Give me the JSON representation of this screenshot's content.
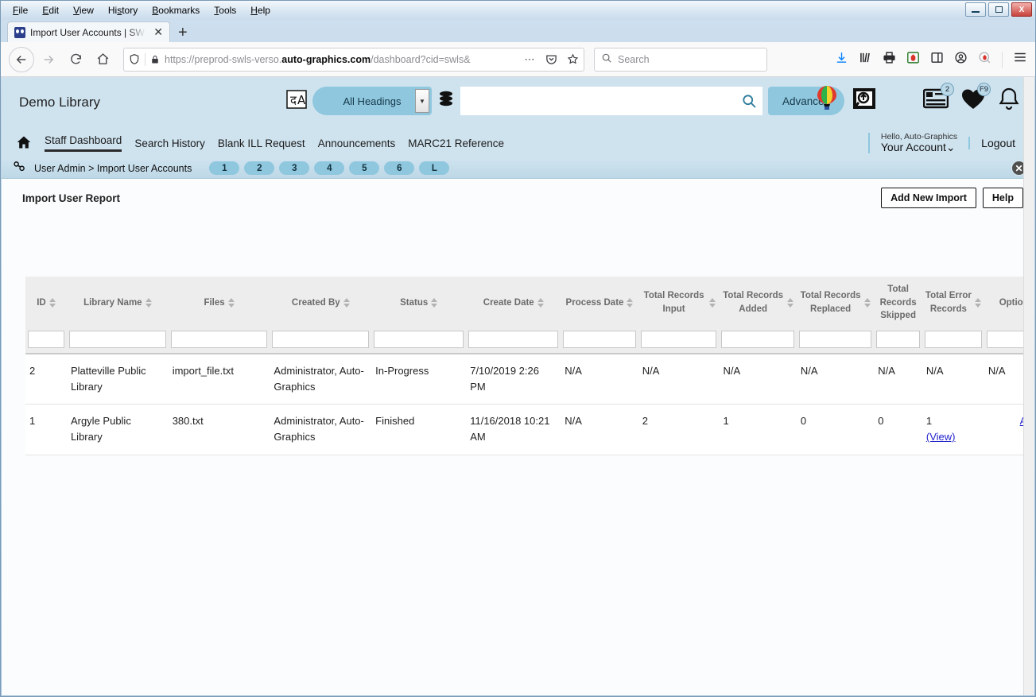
{
  "browser": {
    "menu": [
      "File",
      "Edit",
      "View",
      "History",
      "Bookmarks",
      "Tools",
      "Help"
    ],
    "window_controls": {
      "minimize": "minimize-button",
      "maximize": "maximize-button",
      "close": "X"
    },
    "tab_title": "Import User Accounts | SWLS | ",
    "tab_close": "✕",
    "new_tab": "+",
    "url_prefix": "https://preprod-swls-verso.",
    "url_domain": "auto-graphics.com",
    "url_suffix": "/dashboard?cid=swls&",
    "search_placeholder": "Search",
    "toolbar_icons": [
      "download-icon",
      "library-icon",
      "print-icon",
      "pocket-icon",
      "sidebar-icon",
      "account-icon",
      "container-icon",
      "hamburger-menu-icon"
    ]
  },
  "app": {
    "brand": "Demo Library",
    "search": {
      "scope_label": "All Headings",
      "scope_caret": "▼",
      "input_value": "",
      "advanced_label": "Advanced",
      "database_icon": "database-icon",
      "translate_icon": "translate-icon",
      "magnifier_icon": "search-icon"
    },
    "header_icons": [
      {
        "name": "balloon-icon",
        "badge": ""
      },
      {
        "name": "search-image-icon",
        "badge": ""
      },
      {
        "name": "list-icon",
        "badge": "2"
      },
      {
        "name": "heart-icon",
        "badge": "F9"
      },
      {
        "name": "bell-icon",
        "badge": ""
      }
    ],
    "nav": {
      "home_icon": "home-icon",
      "items": [
        "Staff Dashboard",
        "Search History",
        "Blank ILL Request",
        "Announcements",
        "MARC21 Reference"
      ],
      "active_index": 0
    },
    "account": {
      "hello": "Hello, Auto-Graphics",
      "your_account": "Your Account",
      "caret": "⌄",
      "logout": "Logout"
    },
    "breadcrumb": {
      "icon": "link-icon",
      "text": "User Admin > Import User Accounts",
      "pills": [
        "1",
        "2",
        "3",
        "4",
        "5",
        "6",
        "L"
      ],
      "close": "✕"
    },
    "report": {
      "title": "Import User Report",
      "add_new_import": "Add New Import",
      "help": "Help",
      "gear_icon": "gear-icon",
      "collapse_arrow": "❮"
    }
  },
  "table": {
    "columns": [
      {
        "label": "ID",
        "sortable": true
      },
      {
        "label": "Library Name",
        "sortable": true
      },
      {
        "label": "Files",
        "sortable": true
      },
      {
        "label": "Created By",
        "sortable": true
      },
      {
        "label": "Status",
        "sortable": true
      },
      {
        "label": "Create Date",
        "sortable": true
      },
      {
        "label": "Process Date",
        "sortable": true
      },
      {
        "label": "Total Records Input",
        "sortable": true
      },
      {
        "label": "Total Records Added",
        "sortable": true
      },
      {
        "label": "Total Records Replaced",
        "sortable": true
      },
      {
        "label": "Total Records Skipped",
        "sortable": false
      },
      {
        "label": "Total Error Records",
        "sortable": true
      },
      {
        "label": "Options",
        "sortable": true
      }
    ],
    "filters": [
      "",
      "",
      "",
      "",
      "",
      "",
      "",
      "",
      "",
      "",
      "",
      "",
      ""
    ],
    "rows": [
      {
        "id": "2",
        "library_name": "Platteville Public Library",
        "files": "import_file.txt",
        "created_by": "Administrator, Auto-Graphics",
        "status": "In-Progress",
        "create_date": "7/10/2019 2:26 PM",
        "process_date": "N/A",
        "total_records_input": "N/A",
        "total_records_added": "N/A",
        "total_records_replaced": "N/A",
        "total_records_skipped": "N/A",
        "total_error_records": "N/A",
        "error_view_link": "",
        "options": "N/A"
      },
      {
        "id": "1",
        "library_name": "Argyle Public Library",
        "files": "380.txt",
        "created_by": "Administrator, Auto-Graphics",
        "status": "Finished",
        "create_date": "11/16/2018 10:21 AM",
        "process_date": "N/A",
        "total_records_input": "2",
        "total_records_added": "1",
        "total_records_replaced": "0",
        "total_records_skipped": "0",
        "total_error_records": "1",
        "error_view_link": "(View)",
        "options": "Archive"
      }
    ]
  },
  "colors": {
    "app_header": "#cfe3ef",
    "accent": "#8fc7de",
    "link": "#2222cc",
    "header_text": "#6b6b6b"
  }
}
